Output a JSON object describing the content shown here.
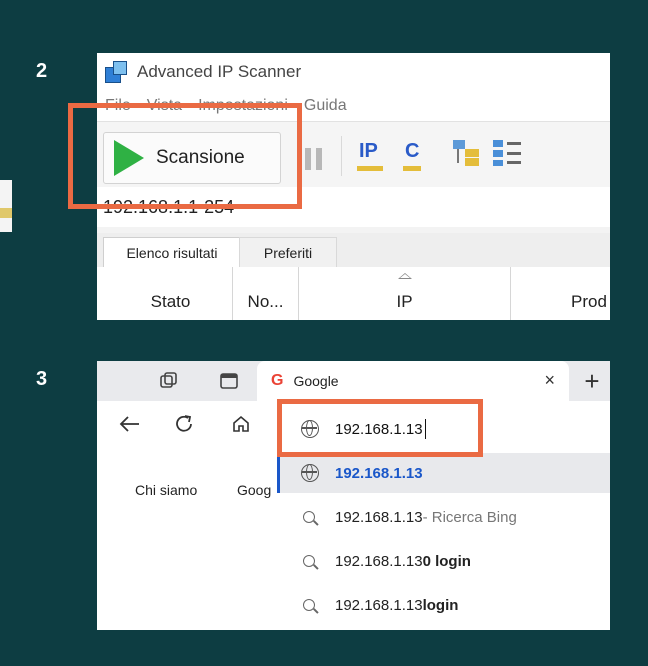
{
  "steps": {
    "first": "2",
    "second": "3"
  },
  "scanner": {
    "title": "Advanced IP Scanner",
    "menu": [
      "File",
      "Vista",
      "Impostazioni",
      "Guida"
    ],
    "scan_button": "Scansione",
    "toolbar_icons": {
      "ip": "IP",
      "c": "C"
    },
    "ip_range": "192.168.1.1-254",
    "tabs": [
      "Elenco risultati",
      "Preferiti"
    ],
    "columns": [
      "Stato",
      "No...",
      "IP",
      "Prod"
    ]
  },
  "browser": {
    "tab_logo": "G",
    "tab_title": "Google",
    "tab_close": "×",
    "new_tab": "+",
    "address_value": "192.168.1.13",
    "page_links": [
      "Chi siamo",
      "Goog"
    ],
    "suggestions": [
      {
        "main": "192.168.1.13",
        "suffix": ""
      },
      {
        "main": "192.168.1.13",
        "suffix": " - Ricerca Bing"
      },
      {
        "main": "192.168.1.13",
        "suffix": "0 login"
      },
      {
        "main": "192.168.1.13",
        "suffix": " login"
      }
    ]
  },
  "colors": {
    "background": "#0d3d42",
    "highlight": "#ea6a43",
    "play": "#2fb144",
    "link_blue": "#1a57c9"
  },
  "icons": [
    "app-icon",
    "play-icon",
    "pause-icon",
    "ip-icon",
    "c-icon",
    "tree-icon",
    "list-icon",
    "workspaces-icon",
    "tab-view-icon",
    "google-logo",
    "close-icon",
    "new-tab-icon",
    "back-icon",
    "reload-icon",
    "home-icon",
    "globe-icon",
    "search-icon"
  ]
}
